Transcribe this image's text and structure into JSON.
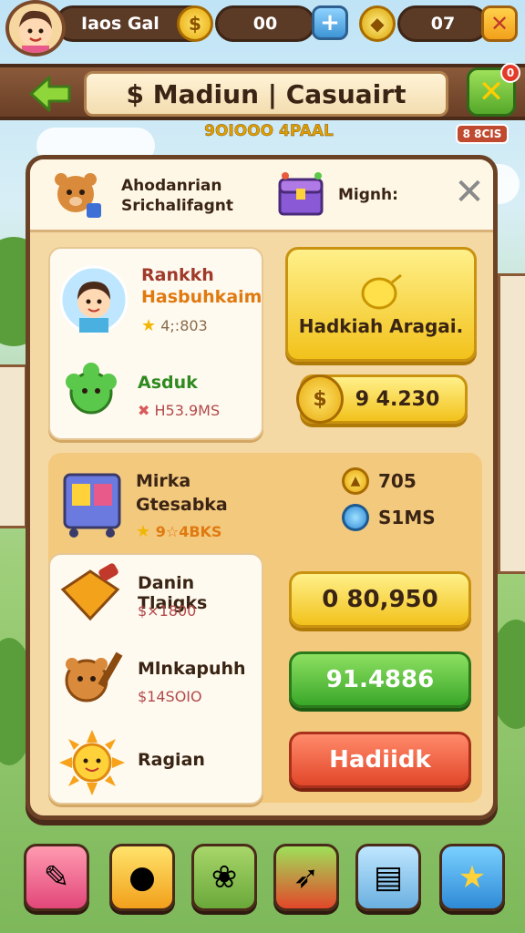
{
  "topbar": {
    "player_name": "Iaos Gal",
    "coins": "00",
    "gems": "07",
    "add_icon": "plus-icon",
    "close_icon": "close-icon"
  },
  "banner": {
    "title": "$ Madiun | Casuairt",
    "subtitle": "9OIOOO 4PAAL",
    "tag": "8 8CIS",
    "notification_count": "0"
  },
  "panel": {
    "header_left": "Ahodanrian Srichalifagnt",
    "header_right": "Mignh:",
    "player_card": {
      "name1": "Rankkh",
      "name2": "Hasbuhkaim",
      "stat": "4;:803",
      "pet_name": "Asduk",
      "pet_stat": "H53.9MS"
    },
    "reward_button": "Hadkiah Aragai.",
    "coin_value": "9 4.230",
    "shop_card": {
      "name1": "Mirka",
      "name2": "Gtesabka",
      "stat": "9☆4BKS"
    },
    "resource_gold": "705",
    "resource_water": "S1MS",
    "items": [
      {
        "title": "Danin Tlaigks",
        "sub": "$×1800"
      },
      {
        "title": "Mlnkapuhh",
        "sub": "$14SOIO"
      },
      {
        "title": "Ragian",
        "sub": ""
      }
    ],
    "buttons": {
      "yellow_value": "0 80,950",
      "green_value": "91.4886",
      "red_label": "Hadiidk"
    }
  },
  "colors": {
    "panel_bg": "#f5d9a4",
    "frame": "#6b4226",
    "yellow": "#f2c21b",
    "green": "#3aa82a",
    "red": "#e2472a"
  }
}
